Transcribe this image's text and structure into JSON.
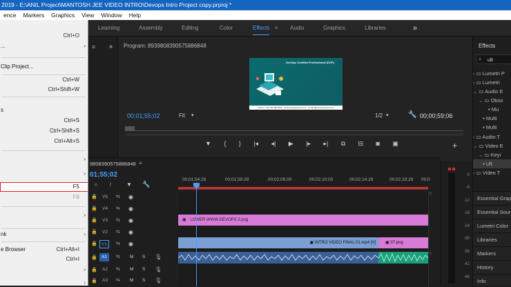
{
  "titlebar": {
    "text": "2019 - E:\\ANIL Project\\MANTOSH JEE VIDEO INTRO\\Devops Intro Project copy.prproj *"
  },
  "menubar": {
    "items": [
      "ence",
      "Markers",
      "Graphics",
      "View",
      "Window",
      "Help"
    ]
  },
  "workspaces": {
    "tabs": [
      "Learning",
      "Assembly",
      "Editing",
      "Color",
      "Effects",
      "Audio",
      "Graphics",
      "Libraries"
    ],
    "active": "Effects",
    "more": "»",
    "menu_icon": "≡"
  },
  "dropdown": {
    "items": [
      {
        "label": "",
        "shortcut": "Ctrl+O"
      },
      {
        "label": "...",
        "shortcut": ""
      },
      {
        "label": "Clip Project...",
        "shortcut": ""
      },
      {
        "label": "",
        "shortcut": "Ctrl+W"
      },
      {
        "label": "",
        "shortcut": "Ctrl+Shift+W"
      },
      {
        "label": "s",
        "shortcut": ""
      },
      {
        "label": "",
        "shortcut": "Ctrl+S"
      },
      {
        "label": "",
        "shortcut": "Ctrl+Shift+S"
      },
      {
        "label": "",
        "shortcut": "Ctrl+Alt+S"
      },
      {
        "label": "",
        "shortcut": "F5"
      },
      {
        "label": "",
        "shortcut": "F6"
      },
      {
        "label": "nk",
        "shortcut": ""
      },
      {
        "label": "e Browser",
        "shortcut": "Ctrl+Alt+I"
      },
      {
        "label": "",
        "shortcut": "Ctrl+I"
      }
    ]
  },
  "program": {
    "title": "Program: 8939808390575886848",
    "menu_icon": "≡",
    "timecode_left": "00;01;55;02",
    "fit": "Fit",
    "resolution": "1/2",
    "timecode_right": "00;00;59;06",
    "video_title": "DevOps Certified Professional (DCP)",
    "video_footer": "Call us: +91 700 483 5930 · www.devopsschool.com · contact@devopsschool.com"
  },
  "timeline": {
    "sequence_name": "9808390575886848",
    "menu_icon": "≡",
    "timecode": "01;55;02",
    "ruler": [
      "00;01;54;28",
      "00;01;59;28",
      "00;02;05;00",
      "00;02;10;00",
      "00;02;14;29",
      "00;02;19;29",
      "00;0"
    ],
    "tracks": [
      "V5",
      "V4",
      "V3",
      "V2",
      "V1",
      "A1",
      "A2",
      "A3"
    ],
    "clips": {
      "v2": "LOWER WWW DEVOPS 2.png",
      "v1a": "INTRO VIDEO FINAL 01.mp4 [V]",
      "v1b": "07.png"
    },
    "audio_m": "M",
    "audio_s": "S"
  },
  "meter": {
    "db_labels": [
      "0",
      "-6",
      "-12",
      "-18",
      "-24",
      "-30",
      "-36",
      "-42",
      "-48"
    ]
  },
  "effects": {
    "title": "Effects",
    "search_value": "ult",
    "tree": [
      "Lumetri P",
      "Lumetri",
      "Audio E",
      "Obso",
      "Mu",
      "Multi",
      "Multi",
      "Audio T",
      "Video E",
      "Keyi",
      "Ult",
      "Video T"
    ],
    "panels": [
      "Essential Grap",
      "Essential Sour",
      "Lumetri Color",
      "Libraries",
      "Markers",
      "History",
      "Info"
    ]
  }
}
